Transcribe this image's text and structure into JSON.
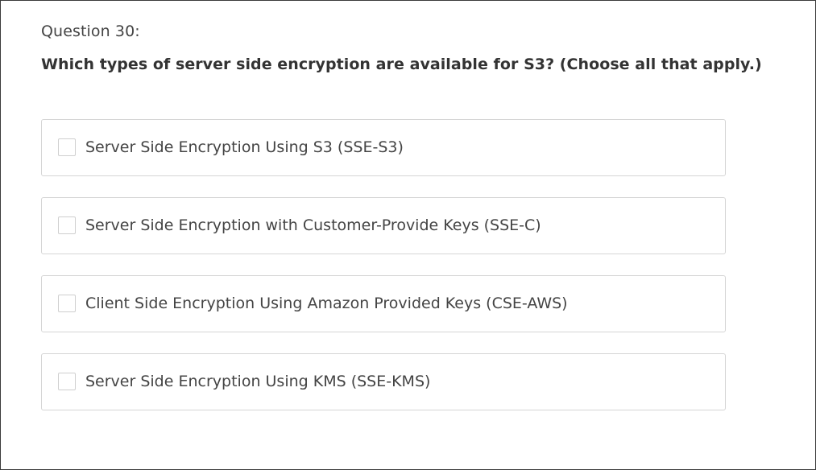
{
  "question": {
    "number_label": "Question 30:",
    "text": "Which types of server side encryption are available for S3? (Choose all that apply.)"
  },
  "options": [
    {
      "label": "Server Side Encryption Using S3 (SSE-S3)",
      "checked": false
    },
    {
      "label": "Server Side Encryption with Customer-Provide Keys (SSE-C)",
      "checked": false
    },
    {
      "label": "Client Side Encryption Using Amazon Provided Keys (CSE-AWS)",
      "checked": false
    },
    {
      "label": "Server Side Encryption Using KMS (SSE-KMS)",
      "checked": false
    }
  ]
}
